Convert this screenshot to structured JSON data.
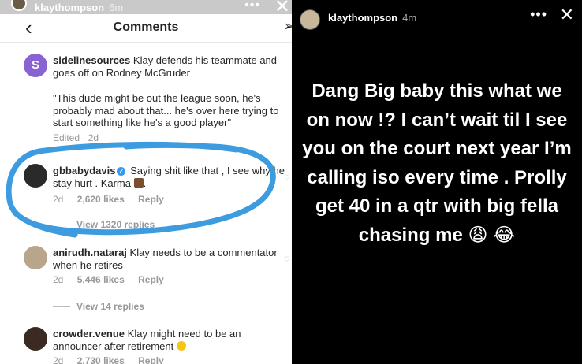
{
  "left_story_header": {
    "username": "klaythompson",
    "time": "6m",
    "more": "•••",
    "close": "✕"
  },
  "nav": {
    "back": "‹",
    "title": "Comments",
    "send": "➢"
  },
  "comments": [
    {
      "username": "sidelinesources",
      "text": "Klay defends his teammate and goes off on Rodney McGruder",
      "quote": "\"This dude might be out the league soon, he's probably mad about that... he's over here trying to start something like he's a good player\"",
      "meta": "Edited · 2d",
      "avatar_letter": "S",
      "avatar_color": "#8a63d2"
    },
    {
      "username": "gbbabydavis",
      "verified": true,
      "text": "Saying shit like that , I see why he stay hurt .  Karma",
      "age": "2d",
      "likes": "2,620 likes",
      "reply": "Reply",
      "view_replies": "View 1320 replies"
    },
    {
      "username": "anirudh.nataraj",
      "text": "Klay needs to be a commentator when he retires",
      "age": "2d",
      "likes": "5,446 likes",
      "reply": "Reply",
      "view_replies": "View 14 replies"
    },
    {
      "username": "crowder.venue",
      "text": "Klay might need to be an announcer after retirement",
      "age": "2d",
      "likes": "2,730 likes",
      "reply": "Reply"
    }
  ],
  "highlight_color": "#3d9be0",
  "story": {
    "username": "klaythompson",
    "time": "4m",
    "more": "•••",
    "close": "✕",
    "text": "Dang Big baby this what we on now !? I can’t wait til I see you on the court next year I’m calling iso every time . Prolly get 40 in a qtr with big fella chasing me 😩 😂"
  }
}
